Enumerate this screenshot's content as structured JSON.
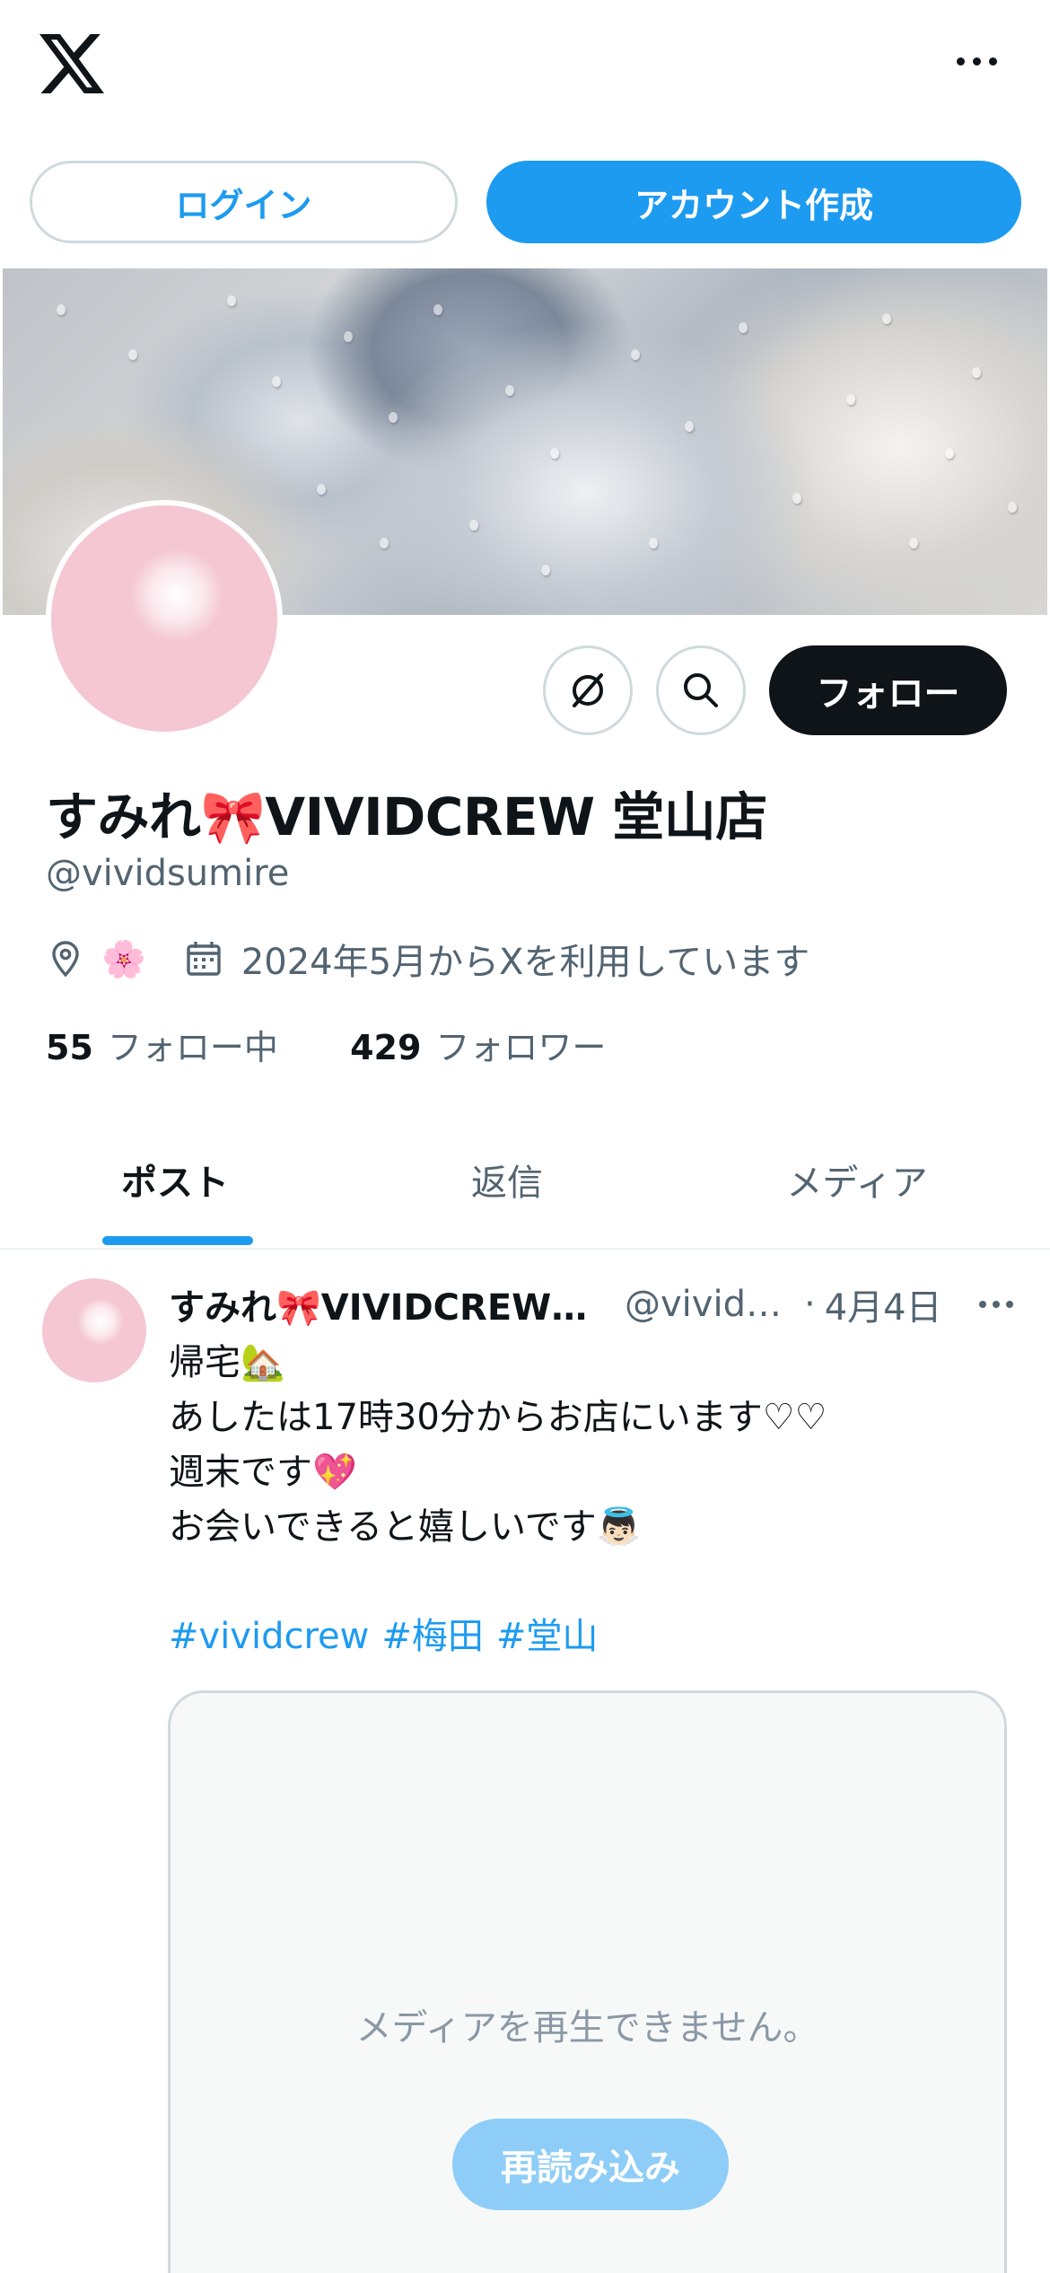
{
  "header": {
    "logo_icon": "x-logo-icon",
    "more_icon": "more-horizontal-icon"
  },
  "auth": {
    "login_label": "ログイン",
    "signup_label": "アカウント作成"
  },
  "profile": {
    "display_name": "すみれ🎀VIVIDCREW 堂山店",
    "handle": "@vividsumire",
    "location_icon": "location-pin-icon",
    "location_emoji": "🌸",
    "calendar_icon": "calendar-icon",
    "joined": "2024年5月からXを利用しています",
    "following_count": "55",
    "following_label": "フォロー中",
    "followers_count": "429",
    "followers_label": "フォロワー"
  },
  "actions": {
    "grok_icon": "grok-icon",
    "search_icon": "search-icon",
    "follow_label": "フォロー"
  },
  "tabs": [
    {
      "label": "ポスト",
      "active": true
    },
    {
      "label": "返信",
      "active": false
    },
    {
      "label": "メディア",
      "active": false
    }
  ],
  "post": {
    "name": "すみれ🎀VIVIDCREW 堂山店",
    "handle": "@vividsumire",
    "separator": "·",
    "date": "4月4日",
    "lines": [
      "帰宅🏡",
      "あしたは17時30分からお店にいます♡♡",
      "週末です💖",
      "お会いできると嬉しいです👼🏻"
    ],
    "hashtags": [
      "#vividcrew",
      "#梅田",
      "#堂山"
    ],
    "media": {
      "message": "メディアを再生できません。",
      "reload_label": "再読み込み"
    }
  },
  "colors": {
    "accent": "#1d9bf0",
    "text": "#0f1419",
    "secondary": "#536471",
    "border": "#cfd9de",
    "follow_bg": "#0f1419"
  }
}
